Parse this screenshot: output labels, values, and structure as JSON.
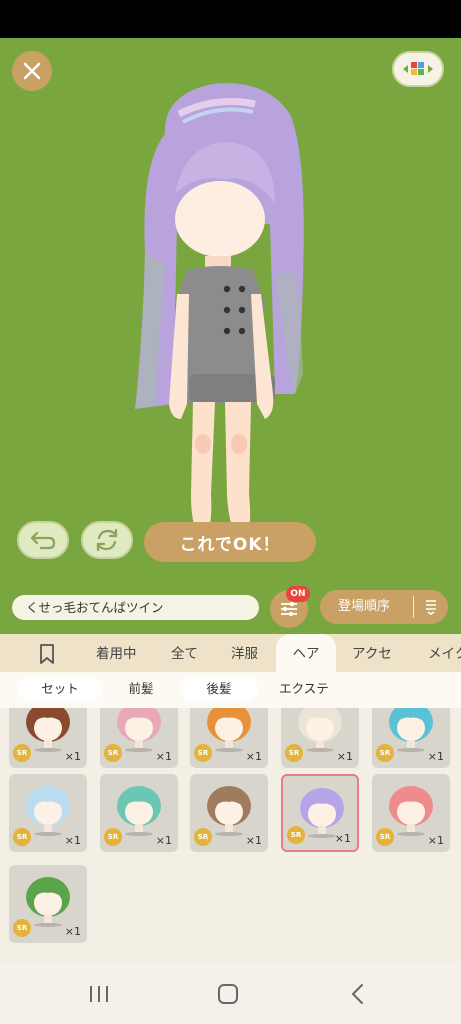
{
  "search": {
    "value": "くせっ毛おてんばツイン"
  },
  "confirm_label": "これでOK！",
  "filter_badge": "ON",
  "sort_label": "登場順序",
  "tabs": [
    "着用中",
    "全て",
    "洋服",
    "ヘア",
    "アクセ",
    "メイク"
  ],
  "active_tab": "ヘア",
  "subtabs": [
    "セット",
    "前髪",
    "後髪",
    "エクステ"
  ],
  "items": [
    {
      "rarity": "SR",
      "count": "×1",
      "color": "#8a4a2e"
    },
    {
      "rarity": "SR",
      "count": "×1",
      "color": "#e8a9b4"
    },
    {
      "rarity": "SR",
      "count": "×1",
      "color": "#e7913a"
    },
    {
      "rarity": "SR",
      "count": "×1",
      "color": "#ece4d6"
    },
    {
      "rarity": "SR",
      "count": "×1",
      "color": "#59c2d6"
    },
    {
      "rarity": "SR",
      "count": "×1",
      "color": "#b9dcf0"
    },
    {
      "rarity": "SR",
      "count": "×1",
      "color": "#6cc6b4"
    },
    {
      "rarity": "SR",
      "count": "×1",
      "color": "#a07c5e"
    },
    {
      "rarity": "SR",
      "count": "×1",
      "color": "#b7a4e6"
    },
    {
      "rarity": "SR",
      "count": "×1",
      "color": "#ef8b8c"
    },
    {
      "rarity": "SR",
      "count": "×1",
      "color": "#5aa44a"
    }
  ],
  "colors": {
    "stage_bg": "#7aa63f",
    "accent": "#c9a164",
    "badge": "#e8463c",
    "selected_border": "#e57b8c"
  },
  "icons": [
    "close-icon",
    "grid-toggle-icon",
    "undo-icon",
    "rotate-icon",
    "filter-sliders-icon",
    "sort-icon",
    "bookmark-icon",
    "recent-apps-icon",
    "home-icon",
    "back-icon"
  ]
}
